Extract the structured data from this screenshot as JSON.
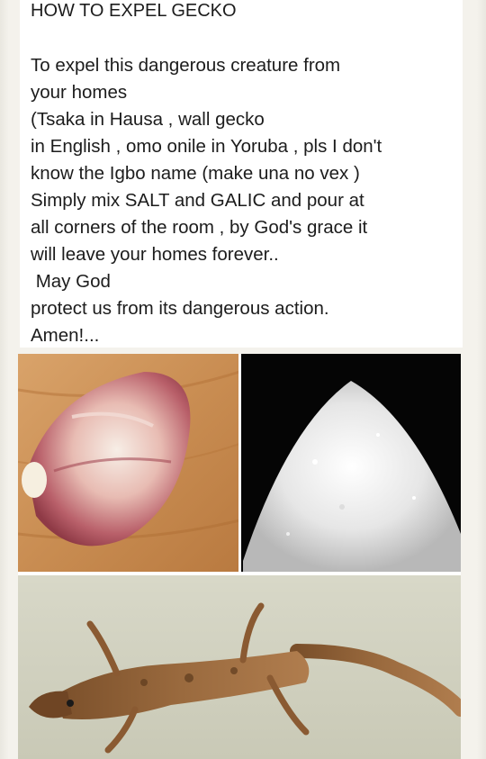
{
  "post": {
    "title": "HOW TO EXPEL GECKO",
    "lines": [
      "To expel this dangerous creature from",
      "your homes",
      "(Tsaka in Hausa , wall gecko",
      "in English , omo onile in Yoruba , pls I don't",
      "know the Igbo name (make una no vex )",
      "Simply mix SALT and GALIC and pour at",
      "all corners of the room , by God's grace it",
      "will leave your homes forever..",
      " May God",
      "protect us from its dangerous action.",
      "Amen!..."
    ]
  },
  "images": {
    "garlic": "garlic clove photo",
    "salt": "salt pile photo",
    "gecko": "wall gecko photo"
  }
}
